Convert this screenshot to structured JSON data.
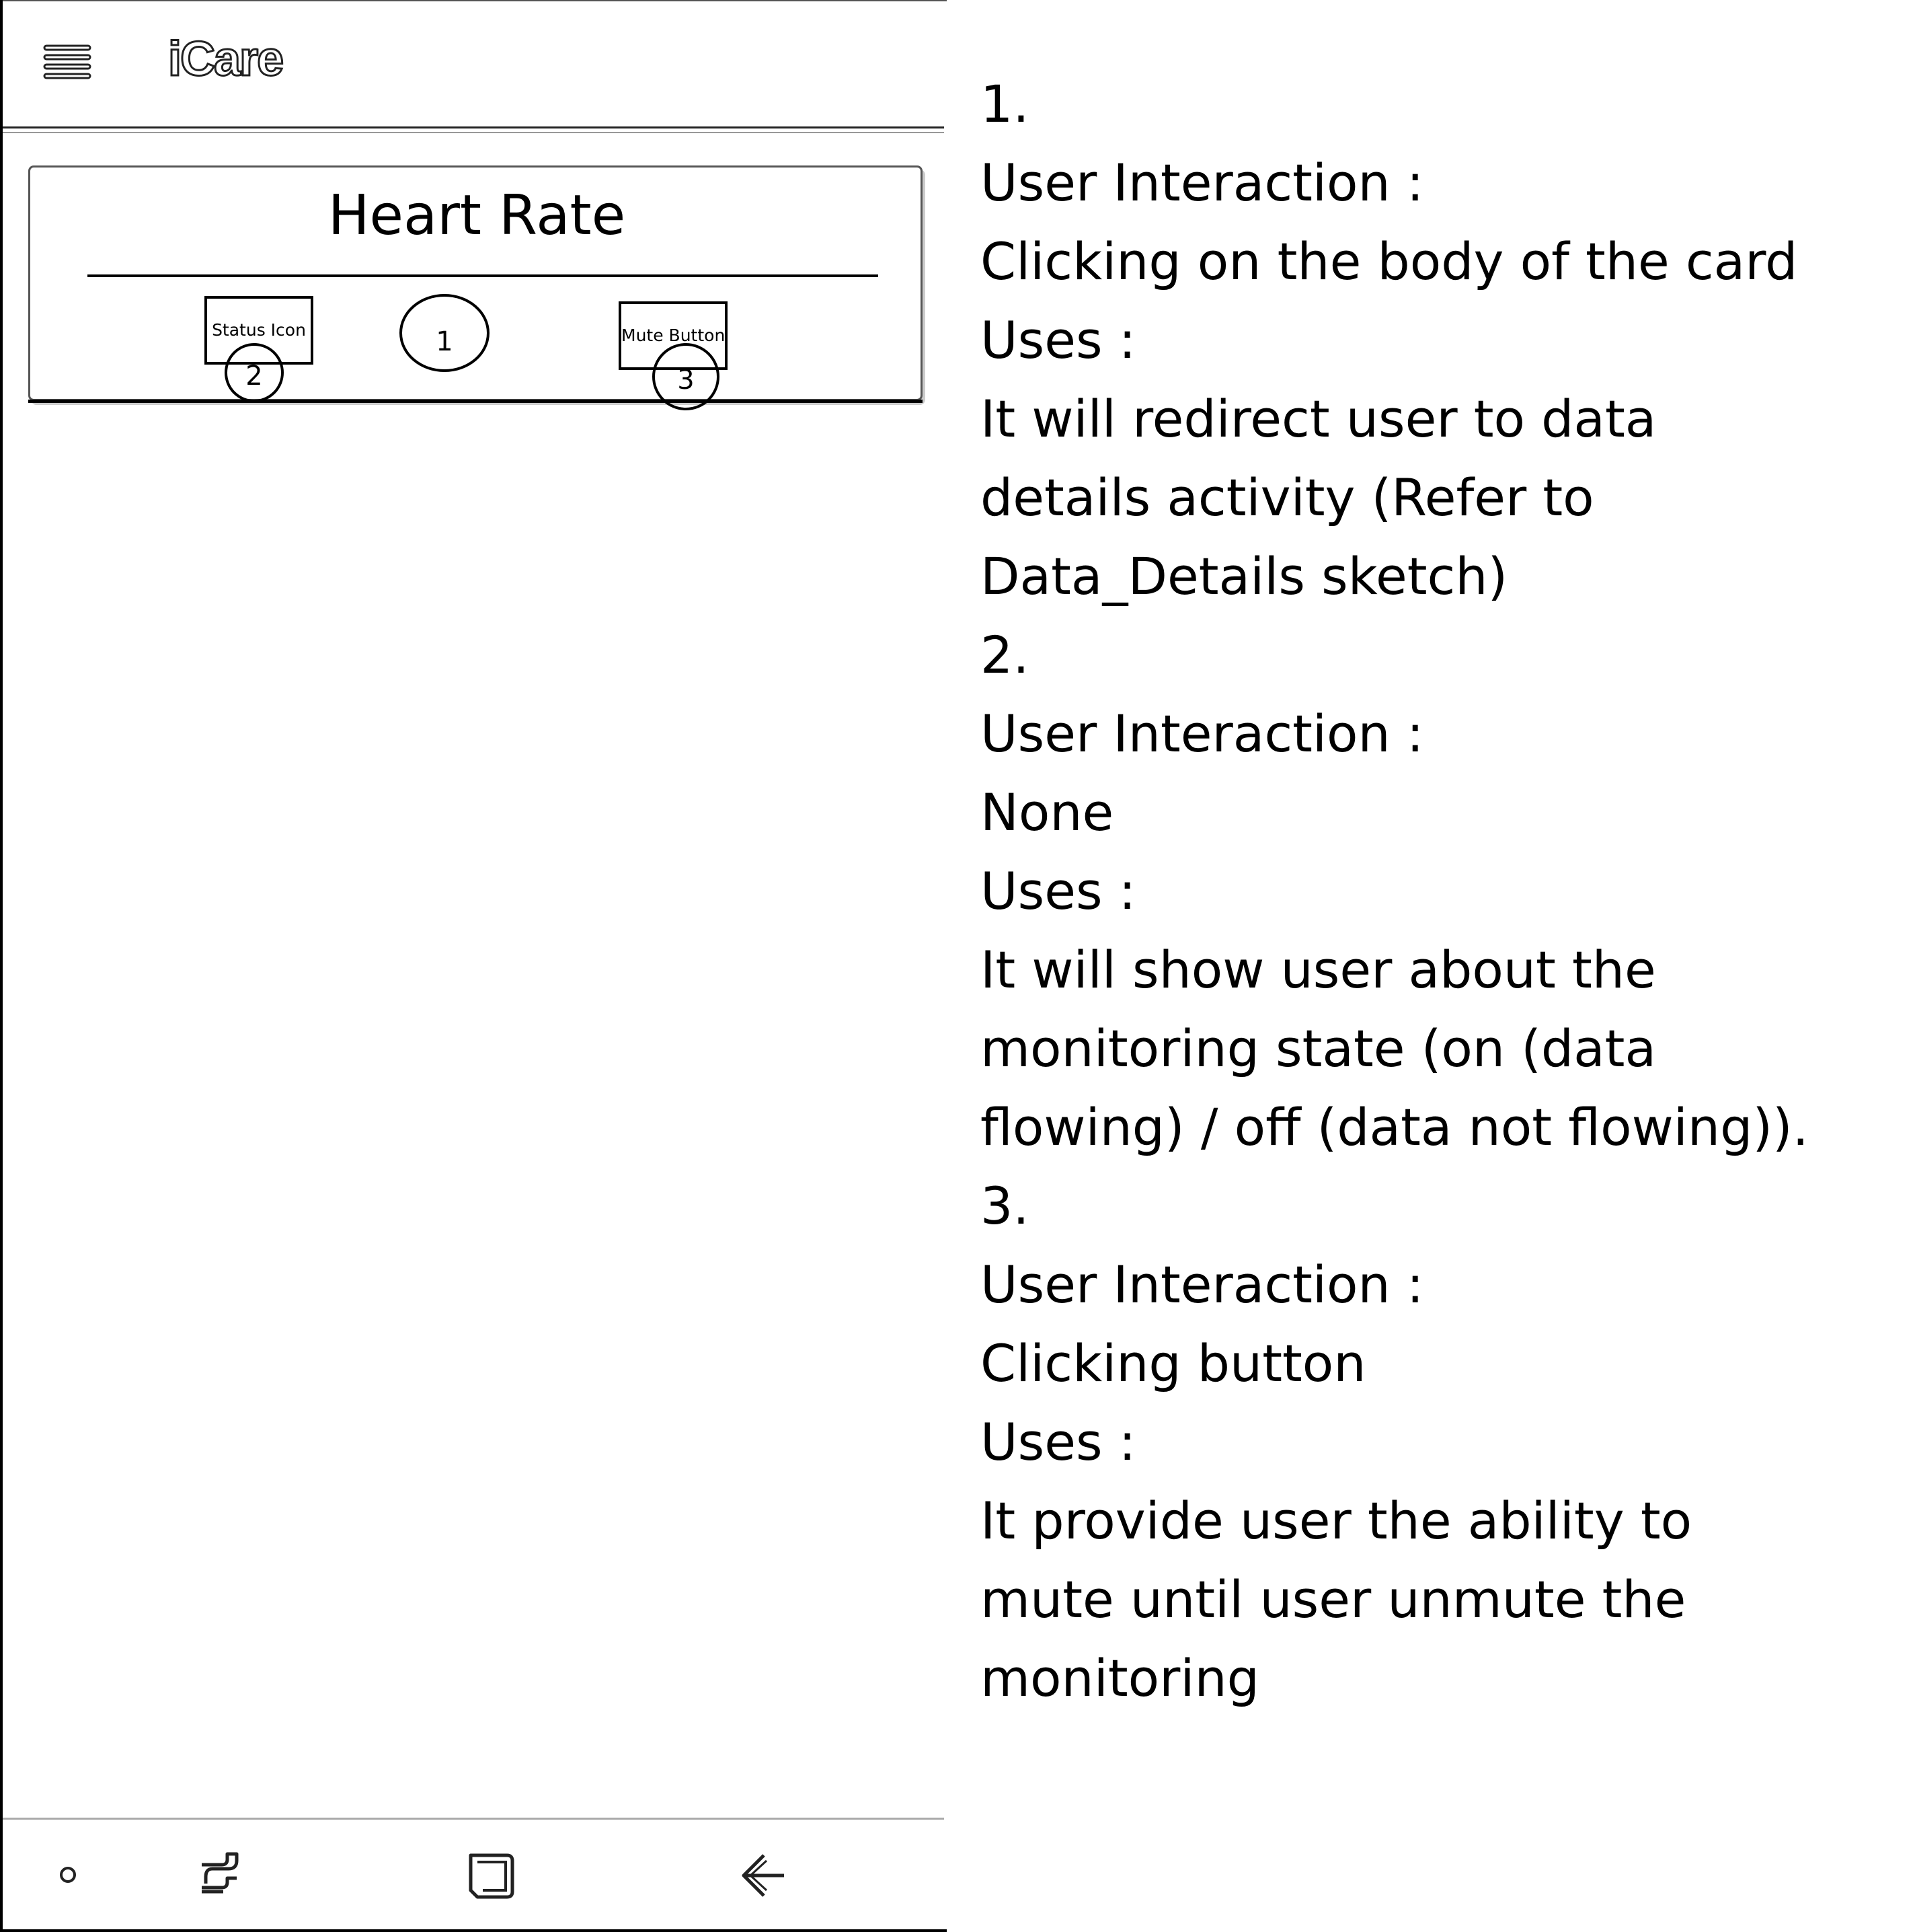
{
  "app": {
    "title": "iCare"
  },
  "card": {
    "title": "Heart Rate",
    "status_icon_label": "Status Icon",
    "mute_button_label": "Mute Button",
    "markers": [
      "1",
      "2",
      "3"
    ]
  },
  "navbar": {
    "icons": [
      "dot-icon",
      "recent-apps-icon",
      "home-icon",
      "back-arrow-icon"
    ]
  },
  "notes": {
    "lines": [
      "1.",
      "User Interaction :",
      "Clicking on the body of the card",
      "Uses :",
      "It will redirect user to data",
      "details activity (Refer to",
      "Data_Details sketch)",
      "2.",
      "User Interaction :",
      "None",
      "Uses :",
      "It will show user about the",
      "monitoring state (on (data",
      "flowing) / off (data not flowing)).",
      "3.",
      "User Interaction :",
      "Clicking button",
      "Uses :",
      "It provide user the ability to",
      "mute until user unmute the",
      "monitoring"
    ]
  },
  "colors": {
    "background": "#ffffff",
    "ink": "#000000",
    "divider": "#aaaaaa"
  }
}
